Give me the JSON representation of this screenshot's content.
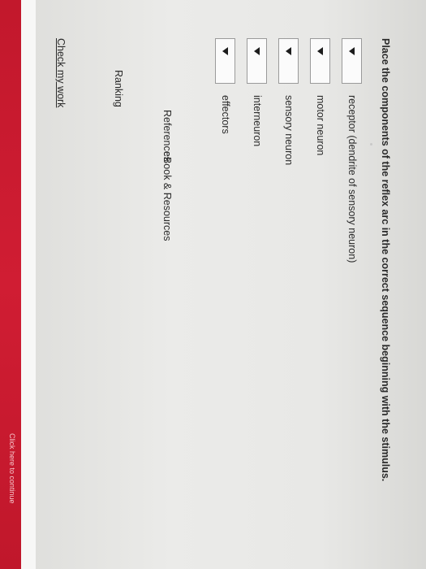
{
  "question": "Place the components of the reflex arc in the correct sequence beginning with the stimulus.",
  "items": [
    {
      "label": "receptor (dendrite of sensory neuron)"
    },
    {
      "label": "motor neuron"
    },
    {
      "label": "sensory neuron"
    },
    {
      "label": "interneuron"
    },
    {
      "label": "effectors"
    }
  ],
  "tabs": {
    "references": "References",
    "ebook": "eBook & Resources",
    "ranking": "Ranking"
  },
  "check_link": "Check my work",
  "footer_button": "Click here to continue",
  "colors": {
    "accent": "#c91b30",
    "text": "#2b2b2b"
  },
  "icons": {
    "select_caret": "caret-down-icon"
  }
}
